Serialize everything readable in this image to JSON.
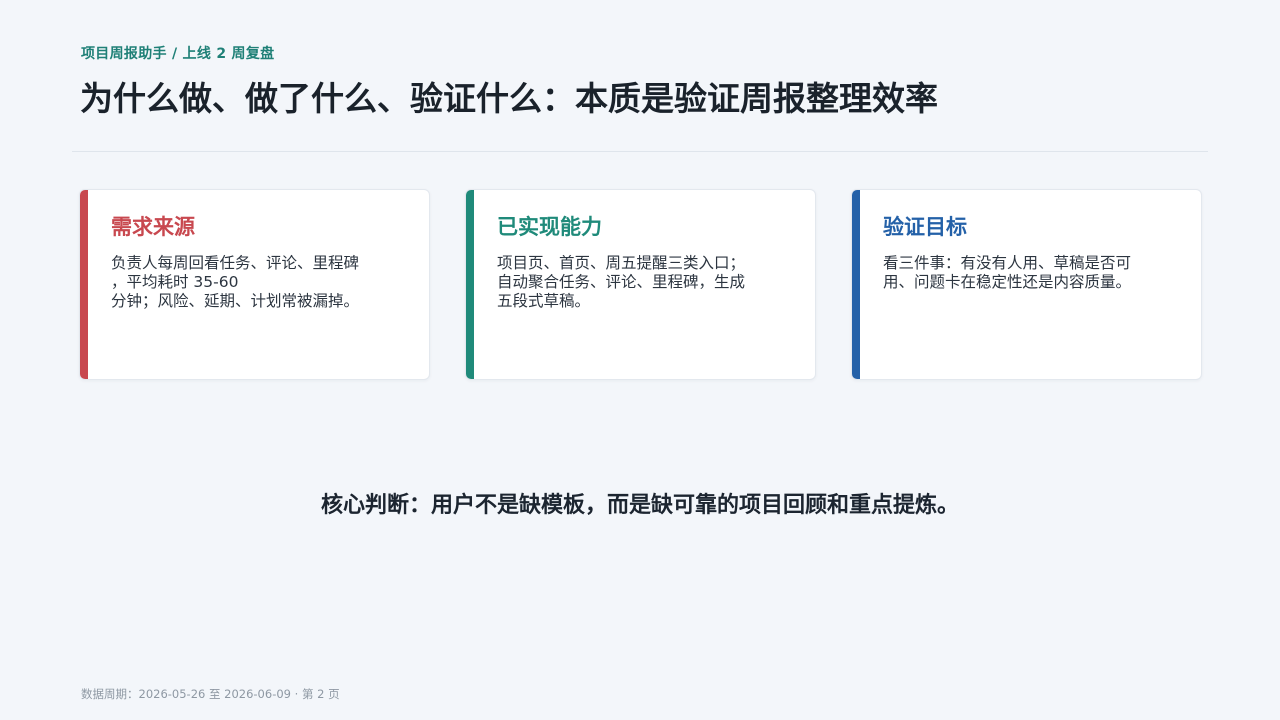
{
  "header": {
    "eyebrow": "项目周报助手 / 上线 2 周复盘",
    "title": "为什么做、做了什么、验证什么：本质是验证周报整理效率"
  },
  "cards": [
    {
      "title": "需求来源",
      "accent": "#c8484f",
      "lines": [
        "负责人每周回看任务、评论、里程碑",
        "，平均耗时 35-60",
        "分钟；风险、延期、计划常被漏掉。"
      ]
    },
    {
      "title": "已实现能力",
      "accent": "#1f8a7a",
      "lines": [
        "项目页、首页、周五提醒三类入口；",
        "自动聚合任务、评论、里程碑，生成",
        "五段式草稿。"
      ]
    },
    {
      "title": "验证目标",
      "accent": "#2461a8",
      "lines": [
        "看三件事：有没有人用、草稿是否可",
        "用、问题卡在稳定性还是内容质量。"
      ]
    }
  ],
  "conclusion": "核心判断：用户不是缺模板，而是缺可靠的项目回顾和重点提炼。",
  "footer": "数据周期：2026-05-26 至 2026-06-09 · 第 2 页"
}
